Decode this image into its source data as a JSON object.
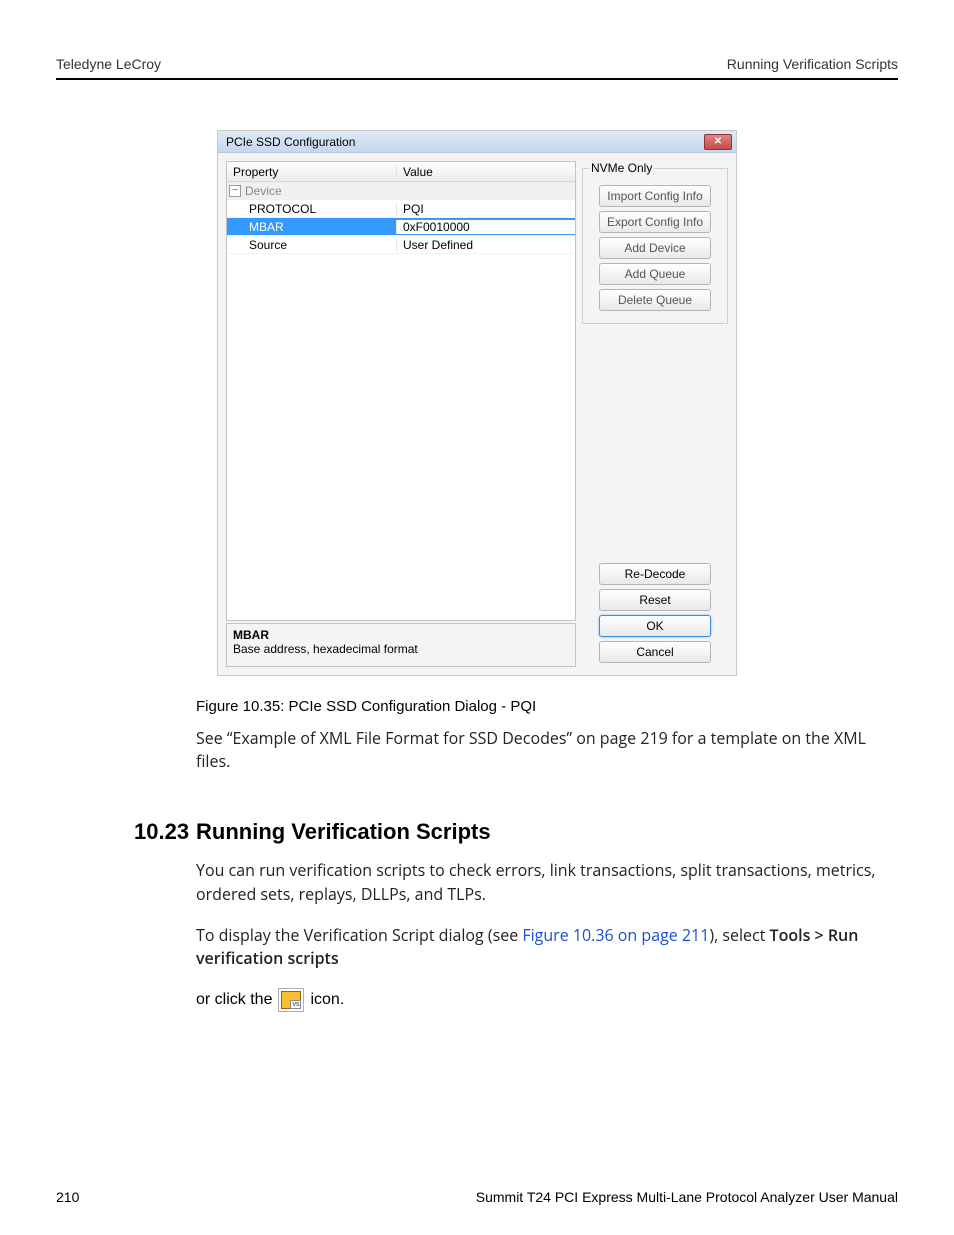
{
  "header": {
    "left": "Teledyne LeCroy",
    "right": "Running Verification Scripts"
  },
  "dialog": {
    "title": "PCIe SSD Configuration",
    "columns": {
      "prop": "Property",
      "val": "Value"
    },
    "group": "Device",
    "rows": [
      {
        "prop": "PROTOCOL",
        "val": "PQI",
        "selected": false
      },
      {
        "prop": "MBAR",
        "val": "0xF0010000",
        "selected": true
      },
      {
        "prop": "Source",
        "val": "User Defined",
        "selected": false
      }
    ],
    "desc": {
      "title": "MBAR",
      "text": "Base address, hexadecimal format"
    },
    "nvme_legend": "NVMe Only",
    "nvme_buttons": [
      "Import Config Info",
      "Export Config Info",
      "Add Device",
      "Add Queue",
      "Delete Queue"
    ],
    "bottom_buttons": {
      "redecode": "Re-Decode",
      "reset": "Reset",
      "ok": "OK",
      "cancel": "Cancel"
    }
  },
  "caption": "Figure 10.35:  PCIe SSD Configuration Dialog - PQI",
  "para1a": "See “Example of XML File Format for SSD Decodes” on page 219 for a template on the XML files.",
  "section": {
    "num": "10.23",
    "title": "Running Verification Scripts"
  },
  "para2": "You can run verification scripts to check errors, link transactions, split transactions, metrics, ordered sets, replays, DLLPs, and TLPs.",
  "para3_pre": "To display the Verification Script dialog (see ",
  "para3_link": "Figure 10.36 on page 211",
  "para3_mid": "), select ",
  "para3_bold": "Tools > Run verification scripts",
  "iconline_pre": "or click the",
  "iconline_post": "icon.",
  "footer": {
    "page": "210",
    "title": "Summit T24 PCI Express Multi-Lane Protocol Analyzer User Manual"
  }
}
